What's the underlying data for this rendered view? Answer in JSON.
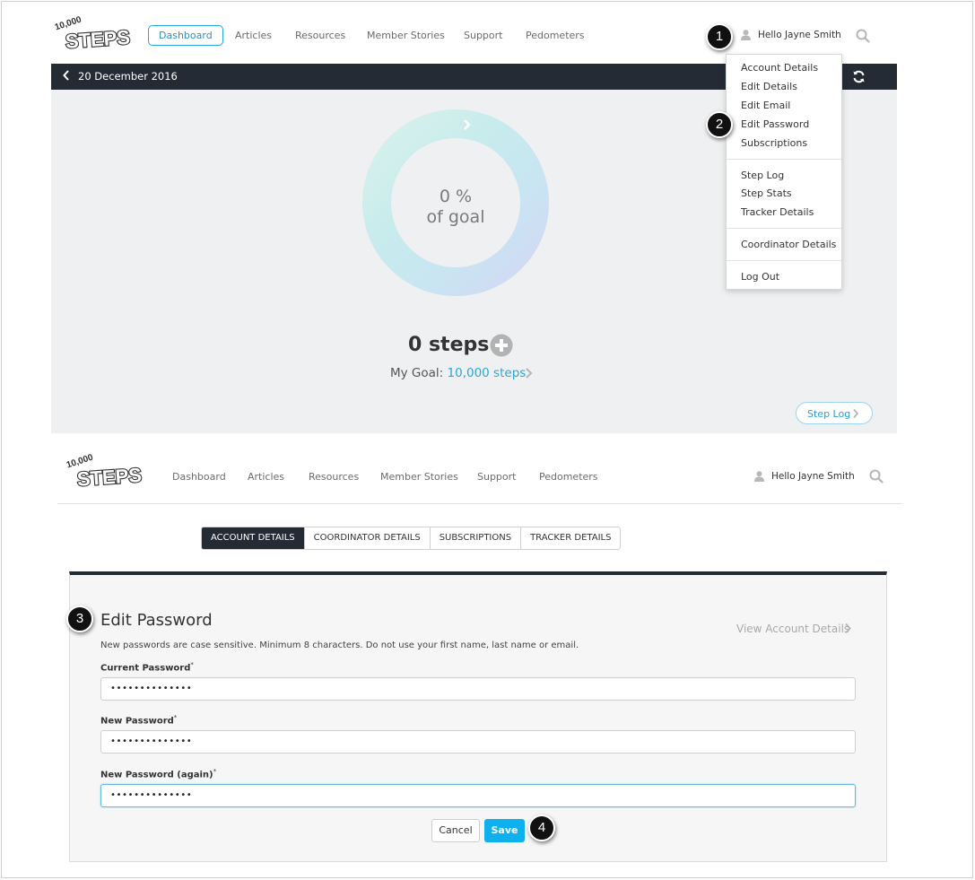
{
  "top": {
    "logo": {
      "number": "10,000",
      "word": "STEPS"
    },
    "nav": {
      "active": "Dashboard",
      "items": [
        "Articles",
        "Resources",
        "Member Stories",
        "Support",
        "Pedometers"
      ]
    },
    "user": {
      "greeting": "Hello Jayne Smith",
      "icon": "user-icon",
      "search_icon": "search-icon"
    },
    "datebar": {
      "date": "20 December 2016",
      "back_icon": "chevron-left-icon",
      "refresh_icon": "refresh-icon"
    },
    "dashboard": {
      "percent": "0 %",
      "percent_caption": "of goal",
      "progress_fraction": 0,
      "steps": "0 steps",
      "goal_label": "My Goal:",
      "goal_value": "10,000 steps",
      "step_log_button": "Step Log"
    },
    "dropdown": {
      "group1": [
        "Account Details",
        "Edit Details",
        "Edit Email",
        "Edit Password",
        "Subscriptions"
      ],
      "group2": [
        "Step Log",
        "Step Stats",
        "Tracker Details"
      ],
      "group3": [
        "Coordinator Details"
      ],
      "group4": [
        "Log Out"
      ]
    }
  },
  "bottom": {
    "logo": {
      "number": "10,000",
      "word": "STEPS"
    },
    "nav": {
      "items": [
        "Dashboard",
        "Articles",
        "Resources",
        "Member Stories",
        "Support",
        "Pedometers"
      ]
    },
    "user": {
      "greeting": "Hello Jayne Smith"
    },
    "tabs": [
      "ACCOUNT DETAILS",
      "COORDINATOR DETAILS",
      "SUBSCRIPTIONS",
      "TRACKER DETAILS"
    ],
    "form": {
      "title": "Edit Password",
      "view_link": "View Account Details",
      "description": "New passwords are case sensitive. Minimum 8 characters. Do not use your first name, last name or email.",
      "current_label": "Current Password",
      "current_value": "••••••••••••••",
      "new_label": "New Password",
      "new_value": "••••••••••••••",
      "again_label": "New Password (again)",
      "again_value": "••••••••••••••",
      "required_mark": "*",
      "cancel": "Cancel",
      "save": "Save"
    }
  },
  "markers": [
    "1",
    "2",
    "3",
    "4"
  ],
  "colors": {
    "dark": "#242b35",
    "accent": "#0eb0ee",
    "link": "#2aa6dc"
  }
}
